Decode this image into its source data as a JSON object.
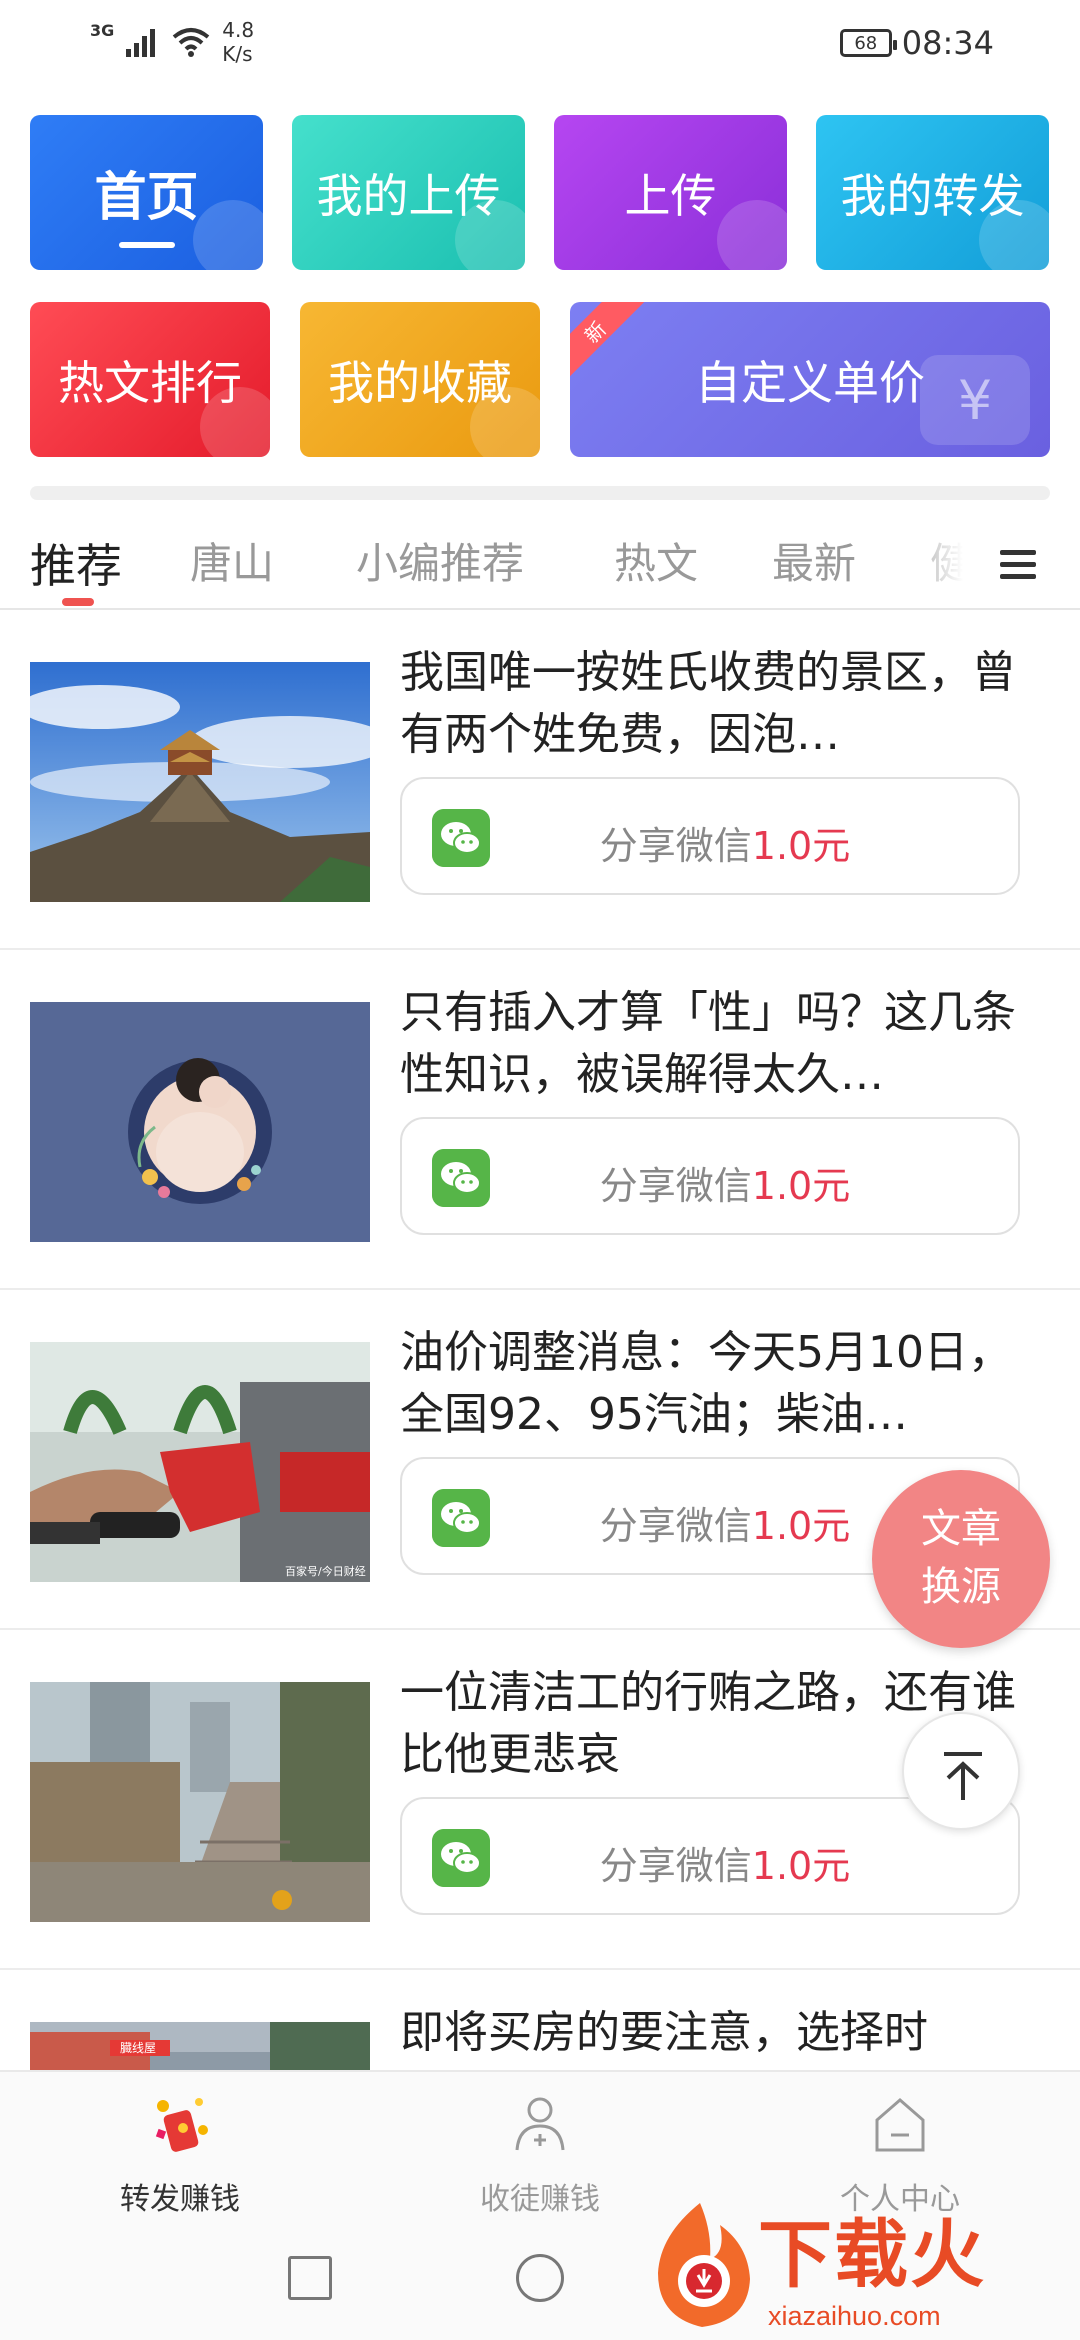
{
  "status_bar": {
    "network": "3G",
    "speed_value": "4.8",
    "speed_unit": "K/s",
    "battery": "68",
    "time": "08:34"
  },
  "grid": {
    "home": "首页",
    "my_uploads": "我的上传",
    "upload": "上传",
    "my_forwards": "我的转发",
    "hot_ranking": "热文排行",
    "my_favorites": "我的收藏",
    "custom_price": "自定义单价",
    "new_badge": "新",
    "yen_symbol": "¥"
  },
  "tabs": [
    "推荐",
    "唐山",
    "小编推荐",
    "热文",
    "最新",
    "健"
  ],
  "articles": [
    {
      "title": "我国唯一按姓氏收费的景区，曾有两个姓免费，因泡…",
      "share_label": "分享微信",
      "amount": "1.0元"
    },
    {
      "title": "只有插入才算「性」吗？这几条性知识，被误解得太久…",
      "share_label": "分享微信",
      "amount": "1.0元"
    },
    {
      "title": "油价调整消息：今天5月10日，全国92、95汽油；柴油…",
      "share_label": "分享微信",
      "amount": "1.0元"
    },
    {
      "title": "一位清洁工的行贿之路，还有谁比他更悲哀",
      "share_label": "分享微信",
      "amount": "1.0元"
    },
    {
      "title": "即将买房的要注意，选择时",
      "share_label": "",
      "amount": ""
    }
  ],
  "thumb_captions": {
    "fuel": "百家号/今日财经",
    "building": "臓线屋"
  },
  "float_buttons": {
    "switch_source_line1": "文章",
    "switch_source_line2": "换源"
  },
  "bottom_nav": [
    {
      "label": "转发赚钱"
    },
    {
      "label": "收徒赚钱"
    },
    {
      "label": "个人中心"
    }
  ],
  "watermark": {
    "text": "下载火",
    "url": "xiazaihuo.com"
  },
  "colors": {
    "accent_red": "#e53950",
    "wechat_green": "#56b548",
    "tab_indicator": "#ef5350"
  }
}
